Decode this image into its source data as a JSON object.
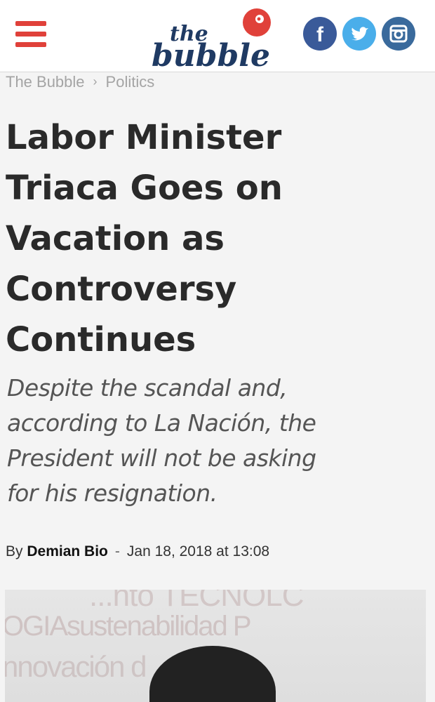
{
  "header": {
    "logo_top": "the",
    "logo_main": "bubble",
    "colors": {
      "accent": "#e0413a",
      "facebook": "#3a5a99",
      "twitter": "#4aaeea",
      "instagram": "#3a6a9c"
    },
    "social": [
      "facebook-icon",
      "twitter-icon",
      "instagram-icon"
    ]
  },
  "breadcrumb": {
    "home": "The Bubble",
    "separator": "›",
    "section": "Politics"
  },
  "article": {
    "title_lines": [
      "Labor Minister",
      "Triaca Goes on",
      "Vacation as",
      "Controversy",
      "Continues"
    ],
    "subtitle_lines": [
      "Despite the scandal and,",
      "according to La Nación, the",
      "President will not be asking",
      "for his resignation."
    ],
    "byline": {
      "prefix": "By",
      "author": "Demian Bio",
      "separator": "-",
      "date": "Jan 18, 2018 at 13:08"
    }
  },
  "photo": {
    "watermark_lines": [
      "...nto TECNOLC",
      "OGIAsustenabilidad P",
      "nnovación d"
    ]
  }
}
